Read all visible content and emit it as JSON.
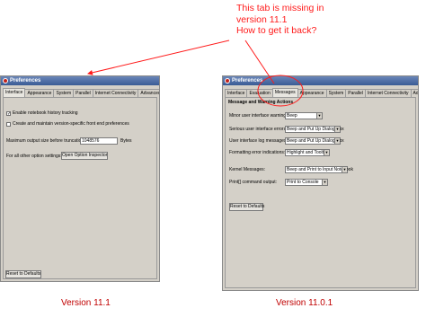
{
  "annotation": {
    "line1": "This tab is missing in",
    "line2": "version 11.1",
    "line3": "How to get it back?"
  },
  "left_window": {
    "title": "Preferences",
    "tabs": [
      "Interface",
      "Appearance",
      "System",
      "Parallel",
      "Internet Connectivity",
      "Advanced"
    ],
    "enable_history_label": "Enable notebook history tracking",
    "version_prefs_label": "Create and maintain version-specific front end preferences",
    "max_output_label": "Maximum output size before truncation:",
    "max_output_value": "1048576",
    "max_output_unit": "Bytes",
    "other_options_label": "For all other option settings:",
    "open_inspector_button": "Open Option Inspector",
    "reset_button": "Reset to Defaults",
    "caption": "Version 11.1"
  },
  "right_window": {
    "title": "Preferences",
    "tabs": [
      "Interface",
      "Evaluation",
      "Messages",
      "Appearance",
      "System",
      "Parallel",
      "Internet Connectivity",
      "Advanced"
    ],
    "section_title": "Message and Warning Actions",
    "rows": [
      {
        "label": "Minor user interface warnings:",
        "value": "Beep"
      },
      {
        "label": "Serious user interface errors:",
        "value": "Beep and Put Up Dialog Box"
      },
      {
        "label": "User interface log messages:",
        "value": "Beep and Put Up Dialog Box"
      },
      {
        "label": "Formatting error indications:",
        "value": "Highlight and Tooltip"
      },
      {
        "label": "Kernel Messages:",
        "value": "Beep and Print to Input Notebook"
      },
      {
        "label": "Print[] command output:",
        "value": "Print to Console"
      }
    ],
    "reset_button": "Reset to Defaults",
    "caption": "Version 11.0.1"
  },
  "colors": {
    "annotation": "#ff1a1a",
    "caption": "#c00000",
    "window_bg": "#d4d0c8",
    "titlebar": "#3a5b95"
  }
}
